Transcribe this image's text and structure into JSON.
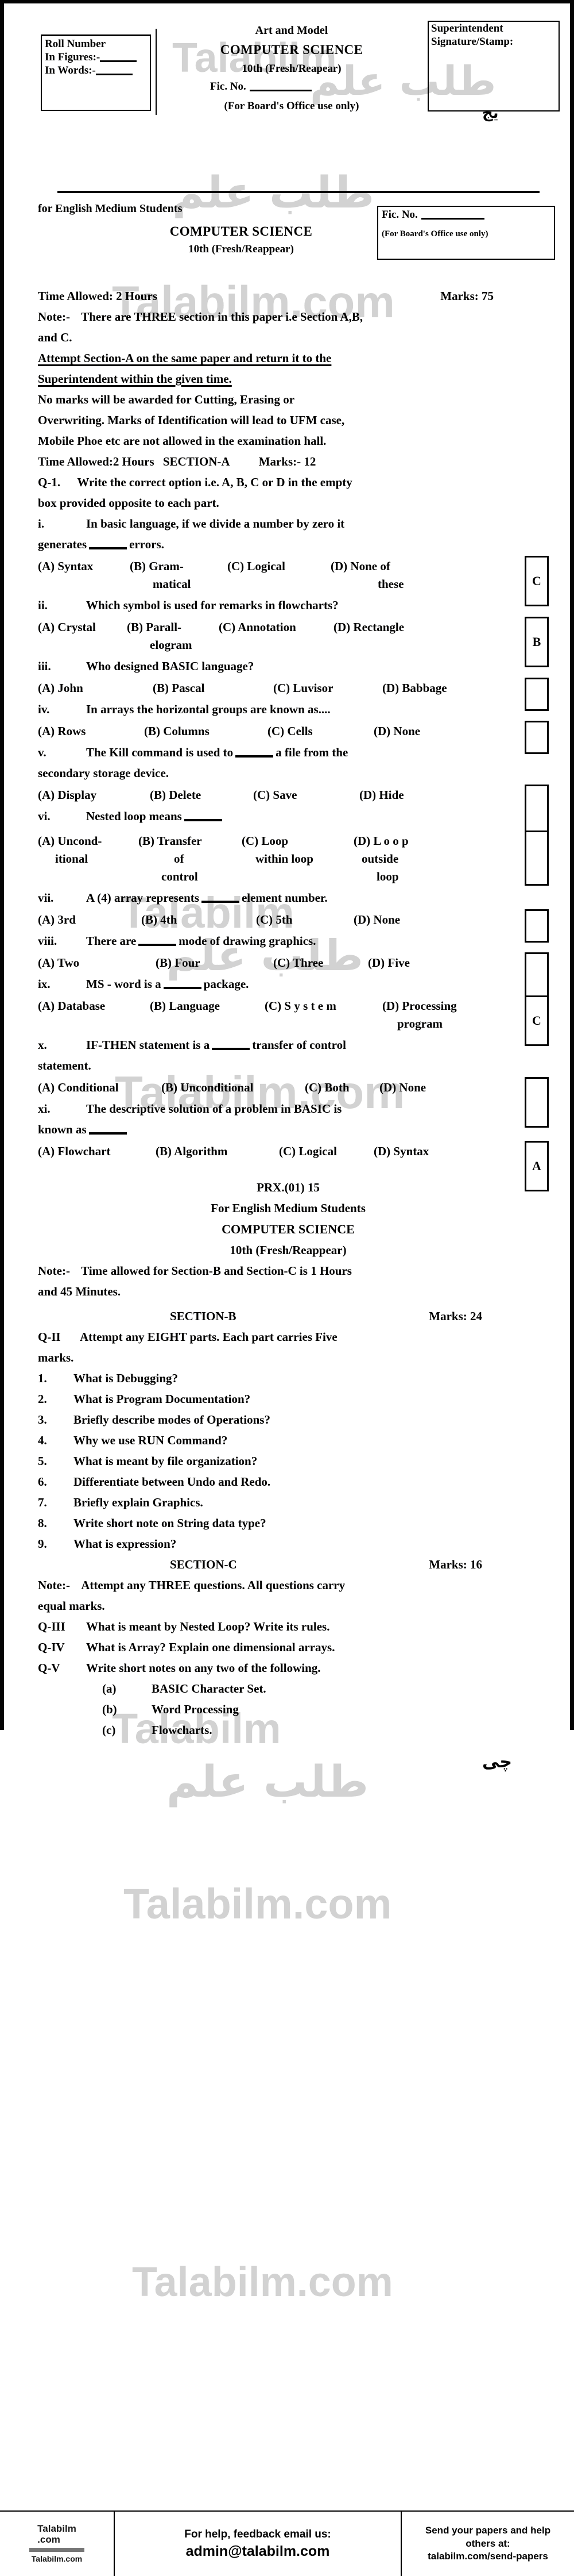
{
  "header": {
    "roll_label": "Roll Number",
    "in_figures": "In Figures:-",
    "in_words": "In Words:-",
    "art_and_model": "Art and Model",
    "subject": "COMPUTER SCIENCE",
    "class_line": "10th (Fresh/Reapear)",
    "fic_no": "Fic. No.",
    "board_use": "(For Board's Office use only)",
    "supt_line1": "Superintendent",
    "supt_line2": "Signature/Stamp:",
    "urdu_mark": "یج"
  },
  "header2": {
    "eng_medium": "for English Medium Students",
    "subject": "COMPUTER SCIENCE",
    "class_line": "10th (Fresh/Reappear)",
    "fic_no": "Fic. No.",
    "board_use": "(For Board's Office use only)"
  },
  "instructions": {
    "time_allowed": "Time Allowed: 2 Hours",
    "marks": "Marks: 75",
    "note_label": "Note:-",
    "note_line1": "There are THREE section in this paper i.e Section A,B,",
    "note_line2": "and C.",
    "attempt_line1": "Attempt Section-A on the same paper and return it to the",
    "attempt_line2": "Superintendent within the given time.",
    "nomarks_line1": "No marks will be awarded for Cutting, Erasing or",
    "nomarks_line2": "Overwriting. Marks of Identification will lead to UFM case,",
    "nomarks_line3": "Mobile Phoe etc are not allowed in the examination hall."
  },
  "section_a": {
    "time_allowed": "Time Allowed:2 Hours",
    "label": "SECTION-A",
    "marks": "Marks:- 12",
    "q1_num": "Q-1.",
    "q1_line1": "Write the correct option i.e. A, B, C or D in the empty",
    "q1_line2": "box provided opposite to each part.",
    "items": [
      {
        "num": "i.",
        "text_line1": "In basic language, if we divide a number by zero it",
        "text_line2": "generates",
        "text_line2b": "errors.",
        "options": [
          "(A)   Syntax",
          "(B)   Gram-",
          "(C) Logical",
          "(D)   None of"
        ],
        "options_wrap": [
          "",
          "matical",
          "",
          "these"
        ],
        "answer": "C"
      },
      {
        "num": "ii.",
        "text_line1": "Which symbol is used for remarks in flowcharts?",
        "options": [
          "(A)  Crystal",
          "(B)   Parall-",
          "(C) Annotation",
          "(D)   Rectangle"
        ],
        "options_wrap": [
          "",
          "elogram",
          "",
          ""
        ],
        "answer": "B"
      },
      {
        "num": "iii.",
        "text_line1": "Who designed BASIC language?",
        "options": [
          "(A)  John",
          "(B) Pascal",
          "(C) Luvisor",
          "(D) Babbage"
        ],
        "answer": ""
      },
      {
        "num": "iv.",
        "text_line1": "In arrays the horizontal groups are known as....",
        "options": [
          "(A) Rows",
          "(B)   Columns",
          "(C) Cells",
          "(D)  None"
        ],
        "answer": ""
      },
      {
        "num": "v.",
        "text_line1": "The Kill command is used to",
        "text_line1b": "a file from the",
        "text_line2": "secondary storage device.",
        "options": [
          "(A)    Display",
          "(B)   Delete",
          "(C) Save",
          "(D)    Hide"
        ],
        "answer": ""
      },
      {
        "num": "vi.",
        "text_line1": "Nested loop means",
        "options": [
          "(A)  Uncond-",
          "(B) Transfer",
          "(C)      Loop",
          "(D) L o o p"
        ],
        "options_wrap": [
          "itional",
          "of",
          "within loop",
          "outside"
        ],
        "options_wrap2": [
          "",
          "control",
          "",
          "loop"
        ],
        "answer": ""
      },
      {
        "num": "vii.",
        "text_line1": "A (4) array represents",
        "text_line1b": "element number.",
        "options": [
          "(A)    3rd",
          "(B)     4th",
          "(C)   5th",
          "(D)  None"
        ],
        "answer": ""
      },
      {
        "num": "viii.",
        "text_line1": "There are",
        "text_line1b": "mode of drawing graphics.",
        "options": [
          "(A) Two",
          "(B)    Four",
          "(C) Three",
          "(D) Five"
        ],
        "answer": ""
      },
      {
        "num": "ix.",
        "text_line1": "MS - word is a",
        "text_line1b": "package.",
        "options": [
          "(A) Database",
          "(B) Language",
          "(C) S y s t e m",
          "(D) Processing"
        ],
        "options_wrap": [
          "",
          "",
          "",
          "program"
        ],
        "answer": "C"
      },
      {
        "num": "x.",
        "text_line1": "IF-THEN statement is a",
        "text_line1b": "transfer of control",
        "text_line2": "statement.",
        "options": [
          "(A) Conditional",
          "(B) Unconditional",
          "(C) Both",
          "(D) None"
        ],
        "answer": ""
      },
      {
        "num": "xi.",
        "text_line1": "The descriptive solution of a problem in BASIC is",
        "text_line2": "known as",
        "options": [
          "(A)  Flowchart",
          "(B)   Algorithm",
          "(C)  Logical",
          "(D)    Syntax"
        ],
        "answer": "A"
      }
    ]
  },
  "page2": {
    "code": "PRX.(01) 15",
    "eng_medium": "For English Medium Students",
    "subject": "COMPUTER SCIENCE",
    "class_line": "10th (Fresh/Reappear)",
    "note_label": "Note:-",
    "note_line1": "Time allowed for Section-B and Section-C is 1 Hours",
    "note_line2": "and 45 Minutes.",
    "urdu_mark": "چی"
  },
  "section_b": {
    "label": "SECTION-B",
    "marks": "Marks: 24",
    "q_num": "Q-II",
    "q_line1": "Attempt any EIGHT parts. Each part carries Five",
    "q_line2": "marks.",
    "items": [
      {
        "num": "1.",
        "text": "What is Debugging?"
      },
      {
        "num": "2.",
        "text": "What is Program Documentation?"
      },
      {
        "num": "3.",
        "text": "Briefly describe modes of Operations?"
      },
      {
        "num": "4.",
        "text": "Why we use RUN Command?"
      },
      {
        "num": "5.",
        "text": "What is meant by file organization?"
      },
      {
        "num": "6.",
        "text": "Differentiate between Undo and Redo."
      },
      {
        "num": "7.",
        "text": "Briefly explain Graphics."
      },
      {
        "num": "8.",
        "text": "Write short note on String data type?"
      },
      {
        "num": "9.",
        "text": "What is expression?"
      }
    ]
  },
  "section_c": {
    "label": "SECTION-C",
    "marks": "Marks: 16",
    "note_label": "Note:-",
    "note_line1": "Attempt any THREE questions. All questions carry",
    "note_line2": "equal marks.",
    "items": [
      {
        "num": "Q-III",
        "text": "What is meant by Nested Loop? Write its rules."
      },
      {
        "num": "Q-IV",
        "text": "What is Array? Explain one dimensional arrays."
      },
      {
        "num": "Q-V",
        "text": "Write short notes on any two of the following."
      }
    ],
    "sub_items": [
      {
        "num": "(a)",
        "text": "BASIC Character Set."
      },
      {
        "num": "(b)",
        "text": "Word Processing"
      },
      {
        "num": "(c)",
        "text": "Flowcharts."
      }
    ]
  },
  "watermarks": {
    "w1": "Talabilm",
    "w2": "Talabilm.com",
    "w3": "طلب علم"
  },
  "footer": {
    "logo_line1": "Talabilm",
    "logo_line2": ".com",
    "logo_line3": "Talabilm.com",
    "help_text": "For help, feedback email us:",
    "email": "admin@talabilm.com",
    "send_line1": "Send your papers and help",
    "send_line2": "others at:",
    "send_line3": "talabilm.com/send-papers"
  }
}
